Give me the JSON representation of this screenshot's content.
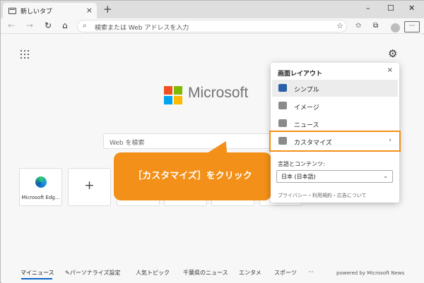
{
  "browser": {
    "tab_title": "新しいタブ",
    "tab_close": "×",
    "new_tab": "+",
    "window_controls": {
      "minimize": "–",
      "maximize": "☐",
      "close": "✕"
    },
    "nav": {
      "back": "←",
      "forward": "→",
      "refresh": "↻",
      "home": "⌂"
    },
    "address_placeholder": "検索または Web アドレスを入力",
    "more_label": "···"
  },
  "page": {
    "logo_text": "Microsoft",
    "logo_colors": [
      "#f25022",
      "#7fba00",
      "#00a4ef",
      "#ffb900"
    ],
    "search_placeholder": "Web を検索",
    "tiles": [
      {
        "label": "Microsoft Edg..."
      },
      {
        "label": "+"
      }
    ]
  },
  "callout": {
    "text": "［カスタマイズ］をクリック",
    "color": "#f39019"
  },
  "layout_panel": {
    "title": "画面レイアウト",
    "close": "×",
    "options": [
      {
        "label": "シンプル",
        "icon": "simple-layout-icon",
        "selected": true
      },
      {
        "label": "イメージ",
        "icon": "image-layout-icon",
        "selected": false
      },
      {
        "label": "ニュース",
        "icon": "news-layout-icon",
        "selected": false
      },
      {
        "label": "カスタマイズ",
        "icon": "pencil-icon",
        "selected": false,
        "has_chevron": true
      }
    ],
    "chevron": "›",
    "language_heading": "言語とコンテンツ:",
    "language_value": "日本 (日本語)",
    "language_chevron": "⌄",
    "footer": "プライバシー・利用規約・広告について",
    "highlight_color": "#f39019"
  },
  "newsbar": {
    "items": [
      "マイニュース",
      "パーソナライズ設定",
      "人気トピック",
      "千葉県のニュース",
      "エンタメ",
      "スポーツ",
      "···"
    ],
    "active_index": 0,
    "powered_by": "powered by Microsoft News",
    "accent": "#0a64c8"
  }
}
